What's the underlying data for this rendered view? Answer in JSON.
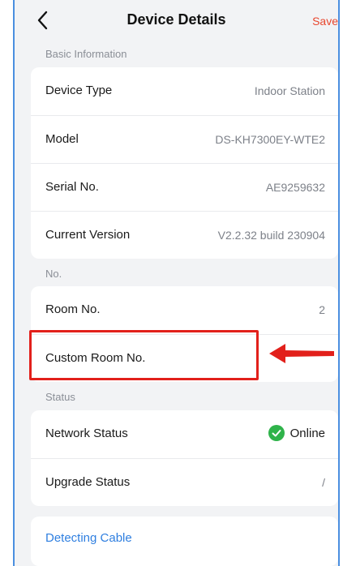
{
  "header": {
    "title": "Device Details",
    "save_label": "Save"
  },
  "sections": {
    "basic": {
      "label": "Basic Information",
      "rows": [
        {
          "key": "Device Type",
          "value": "Indoor Station"
        },
        {
          "key": "Model",
          "value": "DS-KH7300EY-WTE2"
        },
        {
          "key": "Serial No.",
          "value": "AE9259632"
        },
        {
          "key": "Current Version",
          "value": "V2.2.32 build 230904"
        }
      ]
    },
    "no": {
      "label": "No.",
      "rows": [
        {
          "key": "Room No.",
          "value": "2"
        },
        {
          "key": "Custom Room No.",
          "value": ""
        }
      ]
    },
    "status": {
      "label": "Status",
      "rows": [
        {
          "key": "Network Status",
          "value": "Online",
          "icon": "check-circle-icon"
        },
        {
          "key": "Upgrade Status",
          "value": "/"
        }
      ]
    }
  },
  "detecting_cable_label": "Detecting Cable",
  "colors": {
    "accent_red": "#e2201b",
    "save_red": "#e8462e",
    "link_blue": "#2f7fe0",
    "online_green": "#2fb34a"
  }
}
